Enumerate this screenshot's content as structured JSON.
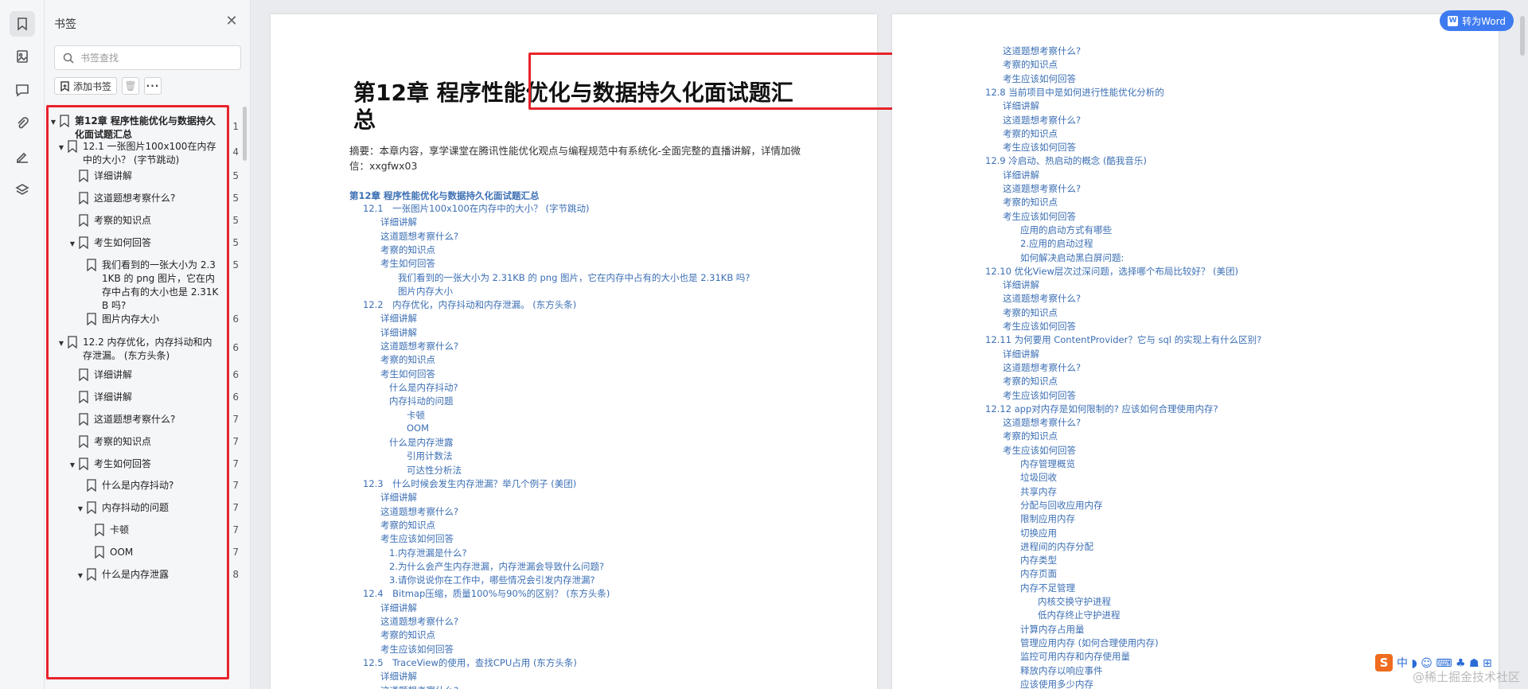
{
  "rail": {
    "icons": [
      "bookmark-icon",
      "thumbnail-icon",
      "comment-icon",
      "attachment-icon",
      "signature-icon",
      "layers-icon"
    ]
  },
  "panel": {
    "title": "书签",
    "search_placeholder": "书签查找",
    "add_bookmark": "添加书签",
    "more": "···"
  },
  "tree": [
    {
      "level": 0,
      "arrow": "▼",
      "text": "第12章 程序性能优化与数据持久化面试题汇总",
      "page": "1",
      "bold": true
    },
    {
      "level": 1,
      "arrow": "▼",
      "text": "12.1 一张图片100x100在内存中的大小？ (字节跳动)",
      "page": "4"
    },
    {
      "level": 2,
      "arrow": "",
      "text": "详细讲解",
      "page": "5"
    },
    {
      "level": 2,
      "arrow": "",
      "text": "这道题想考察什么?",
      "page": "5"
    },
    {
      "level": 2,
      "arrow": "",
      "text": "考察的知识点",
      "page": "5"
    },
    {
      "level": 2,
      "arrow": "▼",
      "text": "考生如何回答",
      "page": "5"
    },
    {
      "level": 3,
      "arrow": "",
      "text": "我们看到的一张大小为 2.31KB 的 png 图片，它在内存中占有的大小也是 2.31KB 吗?",
      "page": "5"
    },
    {
      "level": 3,
      "arrow": "",
      "text": "图片内存大小",
      "page": "6"
    },
    {
      "level": 1,
      "arrow": "▼",
      "text": "12.2 内存优化，内存抖动和内存泄漏。 (东方头条)",
      "page": "6"
    },
    {
      "level": 2,
      "arrow": "",
      "text": "详细讲解",
      "page": "6"
    },
    {
      "level": 2,
      "arrow": "",
      "text": "详细讲解",
      "page": "6"
    },
    {
      "level": 2,
      "arrow": "",
      "text": "这道题想考察什么?",
      "page": "7"
    },
    {
      "level": 2,
      "arrow": "",
      "text": "考察的知识点",
      "page": "7"
    },
    {
      "level": 2,
      "arrow": "▼",
      "text": "考生如何回答",
      "page": "7"
    },
    {
      "level": 3,
      "arrow": "",
      "text": "什么是内存抖动?",
      "page": "7"
    },
    {
      "level": 3,
      "arrow": "▼",
      "text": "内存抖动的问题",
      "page": "7"
    },
    {
      "level": 4,
      "arrow": "",
      "text": "卡顿",
      "page": "7"
    },
    {
      "level": 4,
      "arrow": "",
      "text": "OOM",
      "page": "7"
    },
    {
      "level": 3,
      "arrow": "▼",
      "text": "什么是内存泄露",
      "page": "8"
    }
  ],
  "page1": {
    "chapter_title": "第12章 程序性能优化与数据持久化面试题汇总",
    "abstract": "摘要：本章内容，享学课堂在腾讯性能优化观点与编程规范中有系统化-全面完整的直播讲解，详情加微信：xxgfwx03",
    "toc_head": "第12章 程序性能优化与数据持久化面试题汇总",
    "toc": [
      {
        "indent": 1,
        "text": "12.1　一张图片100x100在内存中的大小？ (字节跳动)"
      },
      {
        "indent": 2,
        "text": "详细讲解"
      },
      {
        "indent": 2,
        "text": "这道题想考察什么?"
      },
      {
        "indent": 2,
        "text": "考察的知识点"
      },
      {
        "indent": 2,
        "text": "考生如何回答"
      },
      {
        "indent": 3,
        "text": "我们看到的一张大小为 2.31KB 的 png 图片，它在内存中占有的大小也是 2.31KB 吗?"
      },
      {
        "indent": 3,
        "text": "图片内存大小"
      },
      {
        "indent": 1,
        "text": "12.2　内存优化，内存抖动和内存泄漏。 (东方头条)"
      },
      {
        "indent": 2,
        "text": "详细讲解"
      },
      {
        "indent": 2,
        "text": "详细讲解"
      },
      {
        "indent": 2,
        "text": "这道题想考察什么?"
      },
      {
        "indent": 2,
        "text": "考察的知识点"
      },
      {
        "indent": 2,
        "text": "考生如何回答"
      },
      {
        "indent": 2.5,
        "text": "什么是内存抖动?"
      },
      {
        "indent": 2.5,
        "text": "内存抖动的问题"
      },
      {
        "indent": 3.5,
        "text": "卡顿"
      },
      {
        "indent": 3.5,
        "text": "OOM"
      },
      {
        "indent": 2.5,
        "text": "什么是内存泄露"
      },
      {
        "indent": 3.5,
        "text": "引用计数法"
      },
      {
        "indent": 3.5,
        "text": "可达性分析法"
      },
      {
        "indent": 1,
        "text": "12.3　什么时候会发生内存泄漏？举几个例子 (美团)"
      },
      {
        "indent": 2,
        "text": "详细讲解"
      },
      {
        "indent": 2,
        "text": "这道题想考察什么?"
      },
      {
        "indent": 2,
        "text": "考察的知识点"
      },
      {
        "indent": 2,
        "text": "考生应该如何回答"
      },
      {
        "indent": 2.5,
        "text": "1.内存泄漏是什么?"
      },
      {
        "indent": 2.5,
        "text": "2.为什么会产生内存泄漏，内存泄漏会导致什么问题?"
      },
      {
        "indent": 2.5,
        "text": "3.请你说说你在工作中，哪些情况会引发内存泄漏?"
      },
      {
        "indent": 1,
        "text": "12.4　Bitmap压缩，质量100%与90%的区别？ (东方头条)"
      },
      {
        "indent": 2,
        "text": "详细讲解"
      },
      {
        "indent": 2,
        "text": "这道题想考察什么?"
      },
      {
        "indent": 2,
        "text": "考察的知识点"
      },
      {
        "indent": 2,
        "text": "考生应该如何回答"
      },
      {
        "indent": 1,
        "text": "12.5　TraceView的使用，查找CPU占用 (东方头条)"
      },
      {
        "indent": 2,
        "text": "详细讲解"
      },
      {
        "indent": 2,
        "text": "这道题想考察什么?"
      }
    ]
  },
  "page2": {
    "toc": [
      {
        "indent": 2,
        "text": "这道题想考察什么?"
      },
      {
        "indent": 2,
        "text": "考察的知识点"
      },
      {
        "indent": 2,
        "text": "考生应该如何回答"
      },
      {
        "indent": 1,
        "text": "12.8  当前项目中是如何进行性能优化分析的"
      },
      {
        "indent": 2,
        "text": "详细讲解"
      },
      {
        "indent": 2,
        "text": "这道题想考察什么?"
      },
      {
        "indent": 2,
        "text": "考察的知识点"
      },
      {
        "indent": 2,
        "text": "考生应该如何回答"
      },
      {
        "indent": 1,
        "text": "12.9  冷启动、热启动的概念 (酷我音乐)"
      },
      {
        "indent": 2,
        "text": "详细讲解"
      },
      {
        "indent": 2,
        "text": "这道题想考察什么?"
      },
      {
        "indent": 2,
        "text": "考察的知识点"
      },
      {
        "indent": 2,
        "text": "考生应该如何回答"
      },
      {
        "indent": 3,
        "text": "应用的启动方式有哪些"
      },
      {
        "indent": 3,
        "text": "2.应用的启动过程"
      },
      {
        "indent": 3,
        "text": "如何解决启动黑白屏问题:"
      },
      {
        "indent": 1,
        "text": "12.10  优化View层次过深问题，选择哪个布局比较好？ (美团)"
      },
      {
        "indent": 2,
        "text": "详细讲解"
      },
      {
        "indent": 2,
        "text": "这道题想考察什么?"
      },
      {
        "indent": 2,
        "text": "考察的知识点"
      },
      {
        "indent": 2,
        "text": "考生应该如何回答"
      },
      {
        "indent": 1,
        "text": "12.11  为何要用 ContentProvider？它与 sql 的实现上有什么区别?"
      },
      {
        "indent": 2,
        "text": "详细讲解"
      },
      {
        "indent": 2,
        "text": "这道题想考察什么?"
      },
      {
        "indent": 2,
        "text": "考察的知识点"
      },
      {
        "indent": 2,
        "text": "考生应该如何回答"
      },
      {
        "indent": 1,
        "text": "12.12  app对内存是如何限制的? 应该如何合理使用内存?"
      },
      {
        "indent": 2,
        "text": "这道题想考察什么?"
      },
      {
        "indent": 2,
        "text": "考察的知识点"
      },
      {
        "indent": 2,
        "text": "考生应该如何回答"
      },
      {
        "indent": 3,
        "text": "内存管理概览"
      },
      {
        "indent": 3,
        "text": "垃圾回收"
      },
      {
        "indent": 3,
        "text": "共享内存"
      },
      {
        "indent": 3,
        "text": "分配与回收应用内存"
      },
      {
        "indent": 3,
        "text": "限制应用内存"
      },
      {
        "indent": 3,
        "text": "切换应用"
      },
      {
        "indent": 3,
        "text": "进程间的内存分配"
      },
      {
        "indent": 3,
        "text": "内存类型"
      },
      {
        "indent": 3,
        "text": "内存页面"
      },
      {
        "indent": 3,
        "text": "内存不足管理"
      },
      {
        "indent": 4,
        "text": "内核交换守护进程"
      },
      {
        "indent": 4,
        "text": "低内存终止守护进程"
      },
      {
        "indent": 3,
        "text": "计算内存占用量"
      },
      {
        "indent": 3,
        "text": "管理应用内存 (如何合理使用内存)"
      },
      {
        "indent": 3,
        "text": "监控可用内存和内存使用量"
      },
      {
        "indent": 3,
        "text": "释放内存以响应事件"
      },
      {
        "indent": 3,
        "text": "应该使用多少内存"
      }
    ]
  },
  "word_button": "转为Word",
  "ime": {
    "logo": "S",
    "text": "中 ◗ ☺ ⌨ ♣ ☗ ⊞"
  },
  "watermark": "@稀土掘金技术社区"
}
